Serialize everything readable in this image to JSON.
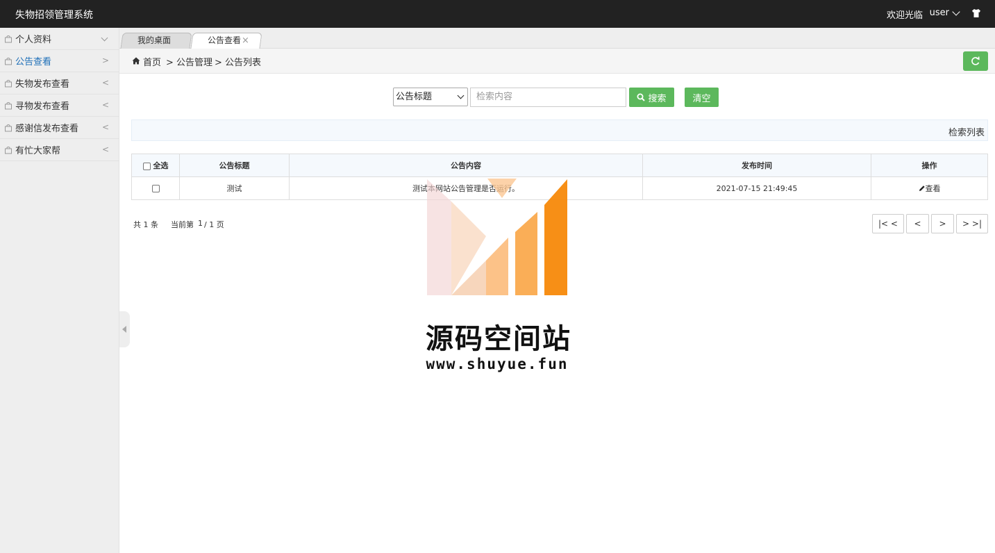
{
  "header": {
    "app_title": "失物招领管理系统",
    "welcome": "欢迎光临",
    "username": "user",
    "icon": "shirt-icon"
  },
  "sidebar": {
    "items": [
      {
        "label": "个人资料",
        "arrow": "v"
      },
      {
        "label": "公告查看",
        "arrow": ">"
      },
      {
        "label": "失物发布查看",
        "arrow": "<"
      },
      {
        "label": "寻物发布查看",
        "arrow": "<"
      },
      {
        "label": "感谢信发布查看",
        "arrow": "<"
      },
      {
        "label": "有忙大家帮",
        "arrow": "<"
      }
    ]
  },
  "tabs": [
    {
      "label": "我的桌面"
    },
    {
      "label": "公告查看",
      "close": "×"
    }
  ],
  "breadcrumb": {
    "home": "首页",
    "level1": "> 公告管理",
    "level2": "> 公告列表"
  },
  "search": {
    "field": "公告标题",
    "placeholder": "检索内容",
    "search_label": "搜索",
    "clear_label": "清空"
  },
  "list_title": "检索列表",
  "table": {
    "headers": [
      "全选",
      "公告标题",
      "公告内容",
      "发布时间",
      "操作"
    ],
    "rows": [
      {
        "title": "测试",
        "content": "测试本网站公告管理是否运行。",
        "time": "2021-07-15 21:49:45",
        "action": "查看"
      }
    ]
  },
  "pager": {
    "total": "共 1 条",
    "current_prefix": "当前第",
    "current": "1",
    "current_suffix": "/ 1 页",
    "first": "|< <",
    "prev": "<",
    "next": ">",
    "last": "> >|"
  },
  "watermark": {
    "title": "源码空间站",
    "url": "www.shuyue.fun"
  },
  "colors": {
    "header_bg": "#222222",
    "accent_green": "#5cb85c",
    "active_blue": "#1e6fb8",
    "watermark_orange": "#f7931e"
  }
}
